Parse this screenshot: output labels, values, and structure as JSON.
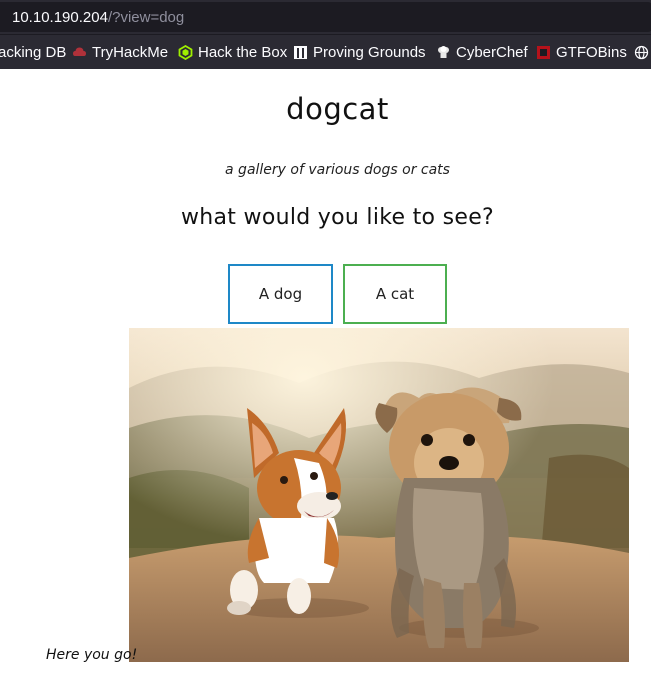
{
  "browser": {
    "url_host": "10.10.190.204",
    "url_path": "/?view=dog",
    "bookmarks": [
      {
        "label": "acking DB",
        "icon": "database-icon"
      },
      {
        "label": "TryHackMe",
        "icon": "tryhackme-icon"
      },
      {
        "label": "Hack the Box",
        "icon": "hackthebox-icon"
      },
      {
        "label": "Proving Grounds",
        "icon": "proving-grounds-icon"
      },
      {
        "label": "CyberChef",
        "icon": "cyberchef-icon"
      },
      {
        "label": "GTFOBins",
        "icon": "gtfobins-icon"
      },
      {
        "label": "",
        "icon": "globe-icon"
      }
    ]
  },
  "page": {
    "title": "dogcat",
    "subtitle": "a gallery of various dogs or cats",
    "question": "what would you like to see?",
    "buttons": {
      "dog": "A dog",
      "cat": "A cat"
    },
    "image_subject": "corgi and yorkshire terrier running on dirt path",
    "caption": "Here you go!"
  },
  "colors": {
    "chrome_bg": "#2b2a33",
    "dog_button_border": "#1e88c7",
    "cat_button_border": "#4caf50"
  }
}
